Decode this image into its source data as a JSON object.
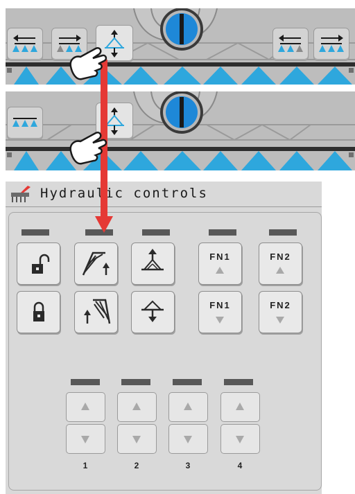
{
  "strip_top": {
    "left_buttons": [
      {
        "icon": "shift-left-icon"
      },
      {
        "icon": "shift-right-icon"
      },
      {
        "icon": "boom-up-down-icon",
        "active": true
      }
    ],
    "right_buttons": [
      {
        "icon": "shift-left-icon"
      },
      {
        "icon": "shift-right-icon"
      }
    ]
  },
  "strip_bottom": {
    "left_buttons": [
      {
        "icon": "boom-level-icon"
      },
      {
        "icon": "boom-up-down-icon",
        "active": true
      }
    ]
  },
  "panel": {
    "title": "Hydraulic controls",
    "header_icon": "sprayer-icon",
    "fn1": "FN1",
    "fn2": "FN2",
    "sections": [
      "1",
      "2",
      "3",
      "4"
    ]
  },
  "colors": {
    "nozzle_blue": "#2ea7dd",
    "arrow_red": "#e53935",
    "strip_gray": "#bdbdbd",
    "panel_gray": "#d9d9d9"
  }
}
